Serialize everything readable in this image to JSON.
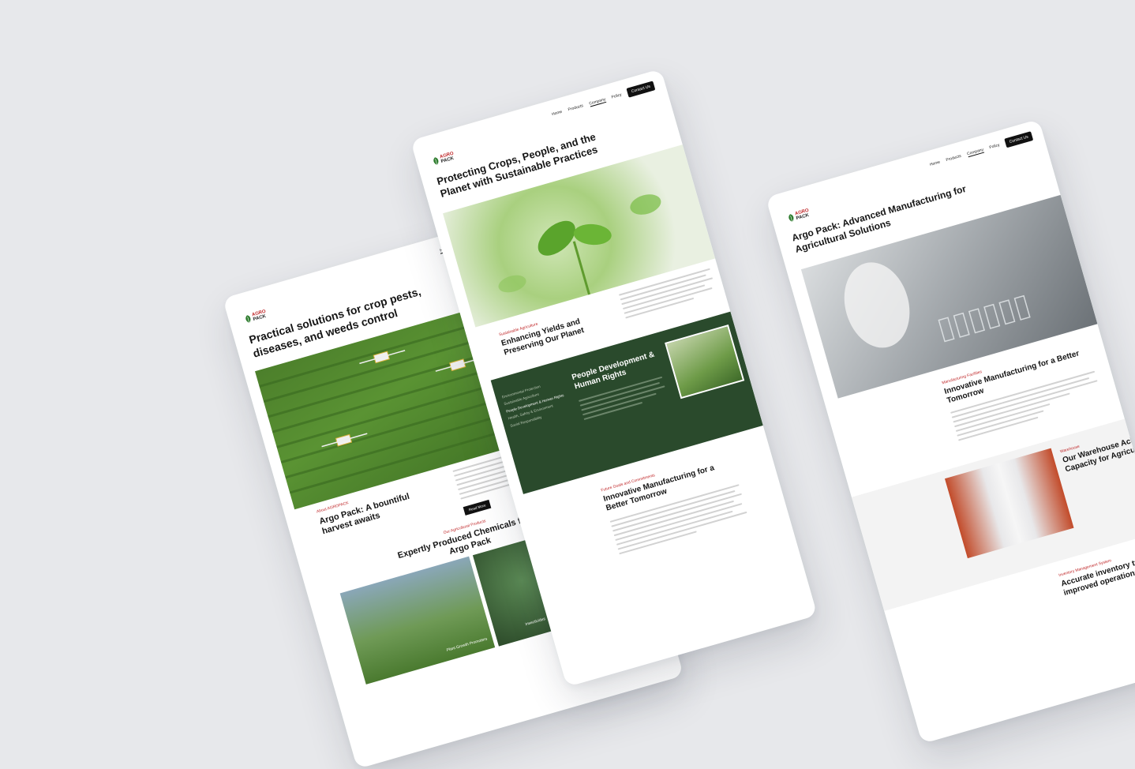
{
  "nav": {
    "home": "Home",
    "products": "Products",
    "company": "Company",
    "policy": "Policy",
    "contact": "Contact Us"
  },
  "logo": {
    "top": "AGRO",
    "bottom": "PACK"
  },
  "left": {
    "hero_title": "Practical solutions for crop pests, diseases, and weeds control",
    "about_kicker": "About AGROPACK",
    "about_title": "Argo Pack: A bountiful harvest awaits",
    "read_more": "Read More",
    "products_kicker": "Our Agricultural Products",
    "products_title": "Expertly Produced Chemicals from Argo Pack",
    "tile_1": "Plant Growth Promoters",
    "tile_2": "Insecticides"
  },
  "middle": {
    "hero_title": "Protecting Crops, People, and the Planet with Sustainable  Practices",
    "sust_kicker": "Sustainable Agriculture",
    "sust_title": "Enhancing Yields and Preserving Our Planet",
    "people_title": "People Development & Human Rights",
    "people_links": [
      "Environmental Protection",
      "Sustainable Agriculture",
      "People Development & Human Rights",
      "Health, Safety & Environment",
      "Social Responsibility"
    ],
    "mfg_kicker": "Future Goals and Commitments",
    "mfg_title": "Innovative Manufacturing for a Better Tomorrow"
  },
  "right": {
    "hero_title": "Argo Pack: Advanced  Manufacturing for Agricultural Solutions",
    "mfg_kicker": "Manufacturing Facilities",
    "mfg_title": "Innovative Manufacturing for a Better Tomorrow",
    "wh_kicker": "Warehouse",
    "wh_title": "Our Warehouse Achieves Record Capacity for Agricultural Chemicals",
    "inv_kicker": "Inventory Management System",
    "inv_title": "Accurate inventory tracking for improved operations"
  }
}
